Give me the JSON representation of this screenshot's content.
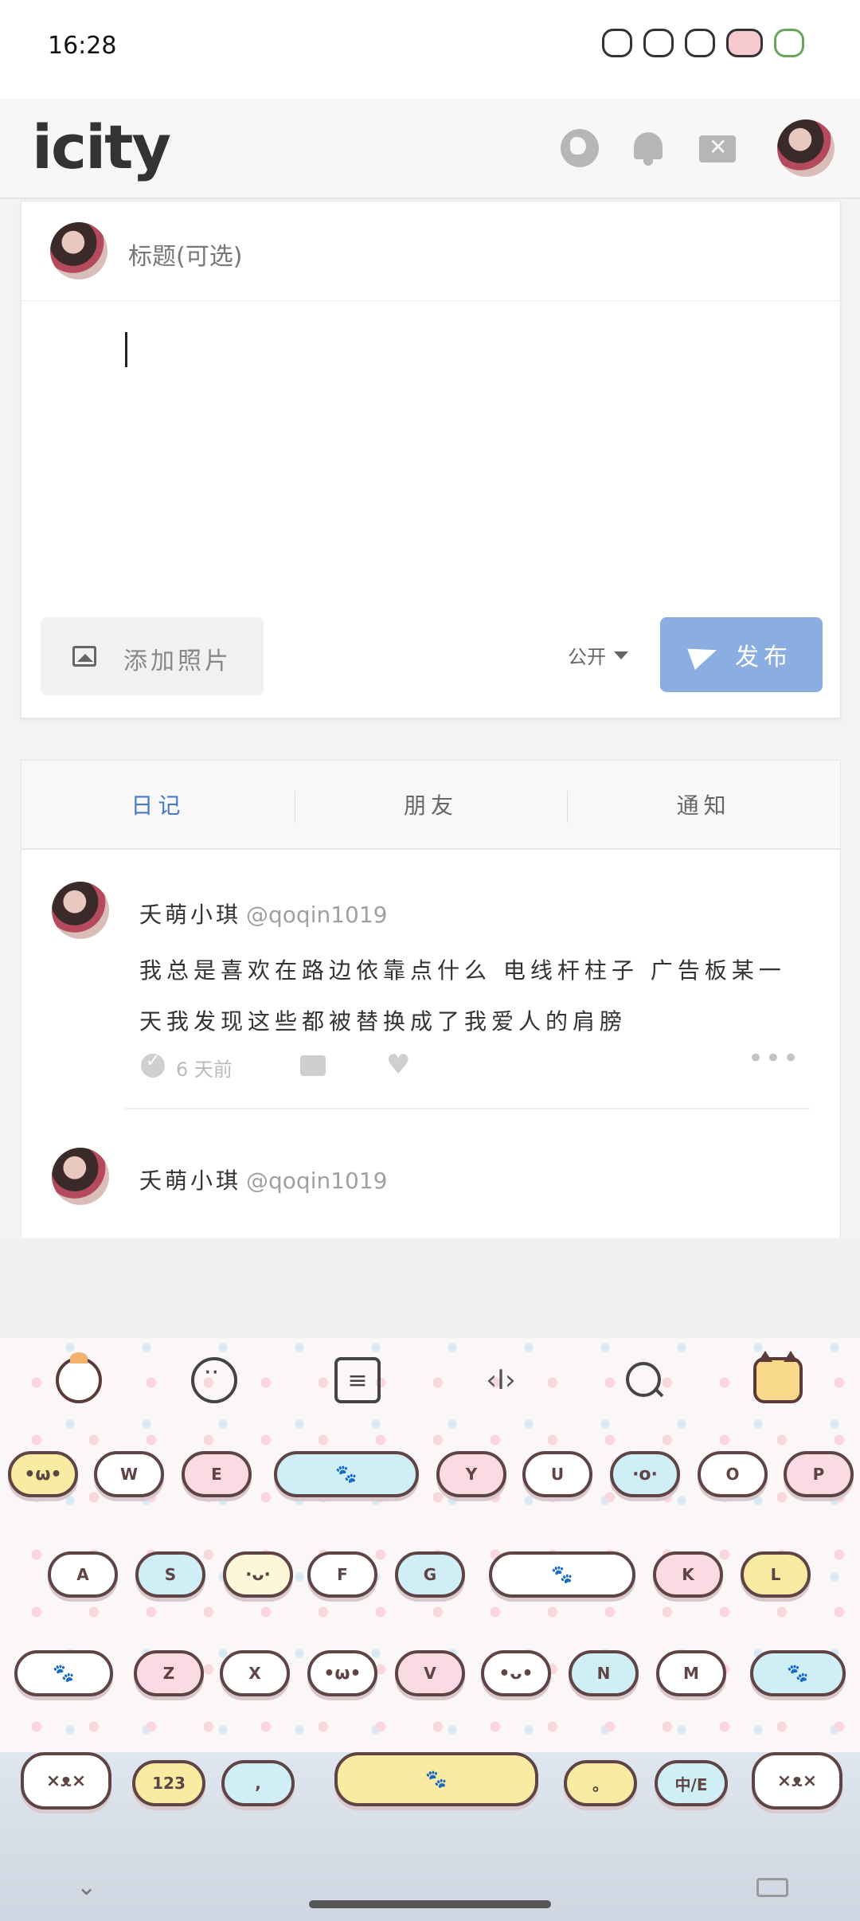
{
  "status_bar": {
    "time": "16:28"
  },
  "header": {
    "logo": "icity",
    "icons": [
      "globe-icon",
      "bell-icon",
      "mail-icon"
    ]
  },
  "composer": {
    "title_placeholder": "标题(可选)",
    "add_photo_label": "添加照片",
    "visibility": "公开",
    "publish_label": "发布"
  },
  "feed": {
    "tabs": [
      {
        "label": "日记",
        "active": true
      },
      {
        "label": "朋友",
        "active": false
      },
      {
        "label": "通知",
        "active": false
      }
    ],
    "posts": [
      {
        "name": "夭萌小琪",
        "handle": "@qoqin1019",
        "text": "我总是喜欢在路边依靠点什么 电线杆柱子 广告板某一天我发现这些都被替换成了我爱人的肩膀",
        "time": "6 天前"
      },
      {
        "name": "夭萌小琪",
        "handle": "@qoqin1019",
        "text": "",
        "time": ""
      }
    ]
  },
  "keyboard": {
    "row1": [
      "W",
      "E",
      "Y",
      "U",
      "O",
      "P"
    ],
    "row2": [
      "A",
      "S",
      "F",
      "G",
      "K",
      "L"
    ],
    "row3": [
      "Z",
      "X",
      "V",
      "N",
      "M"
    ],
    "row4": [
      "123",
      ",",
      "。",
      "中/E"
    ],
    "colors": {
      "pink": "#fadbe3",
      "blue": "#cfeef6",
      "yellow": "#fbeaa2",
      "accent": "#8aaee0"
    }
  }
}
